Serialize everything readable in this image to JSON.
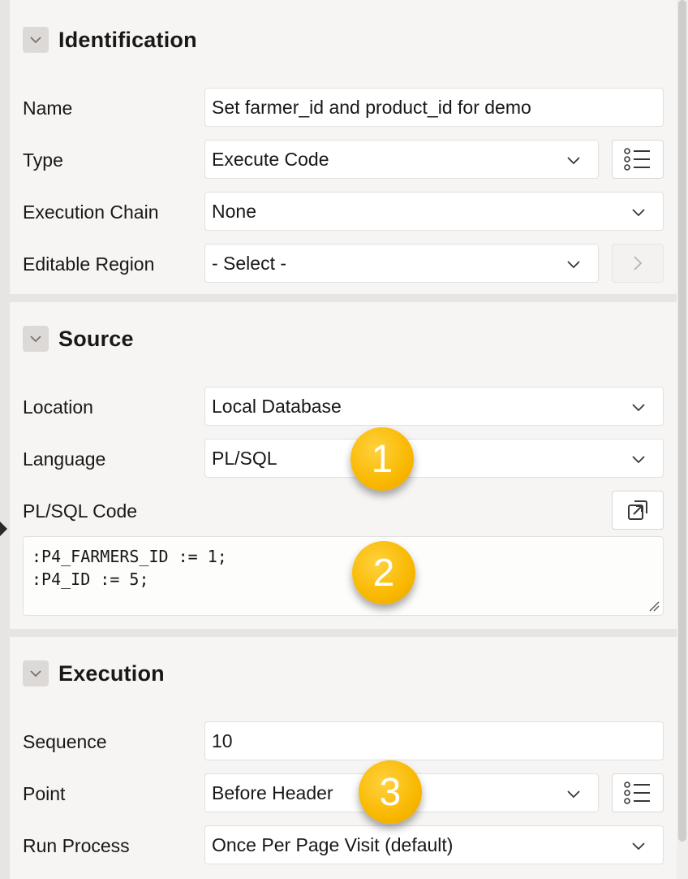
{
  "identification": {
    "title": "Identification",
    "name_label": "Name",
    "name_value": "Set farmer_id and product_id for demo",
    "type_label": "Type",
    "type_value": "Execute Code",
    "execution_chain_label": "Execution Chain",
    "execution_chain_value": "None",
    "editable_region_label": "Editable Region",
    "editable_region_value": "- Select -"
  },
  "source": {
    "title": "Source",
    "location_label": "Location",
    "location_value": "Local Database",
    "language_label": "Language",
    "language_value": "PL/SQL",
    "code_label": "PL/SQL Code",
    "code_lines": [
      ":P4_FARMERS_ID := 1;",
      ":P4_ID := 5;"
    ]
  },
  "execution": {
    "title": "Execution",
    "sequence_label": "Sequence",
    "sequence_value": "10",
    "point_label": "Point",
    "point_value": "Before Header",
    "run_process_label": "Run Process",
    "run_process_value": "Once Per Page Visit (default)"
  },
  "badges": [
    "1",
    "2",
    "3"
  ],
  "icons": {
    "collapse": "chevron-down-icon",
    "dropdown": "chevron-down-icon",
    "list": "list-icon",
    "go": "chevron-right-icon",
    "expand": "open-in-dialog-icon"
  },
  "colors": {
    "badge": "#f9b800",
    "panel": "#f6f5f4",
    "background": "#e7e5e3"
  }
}
